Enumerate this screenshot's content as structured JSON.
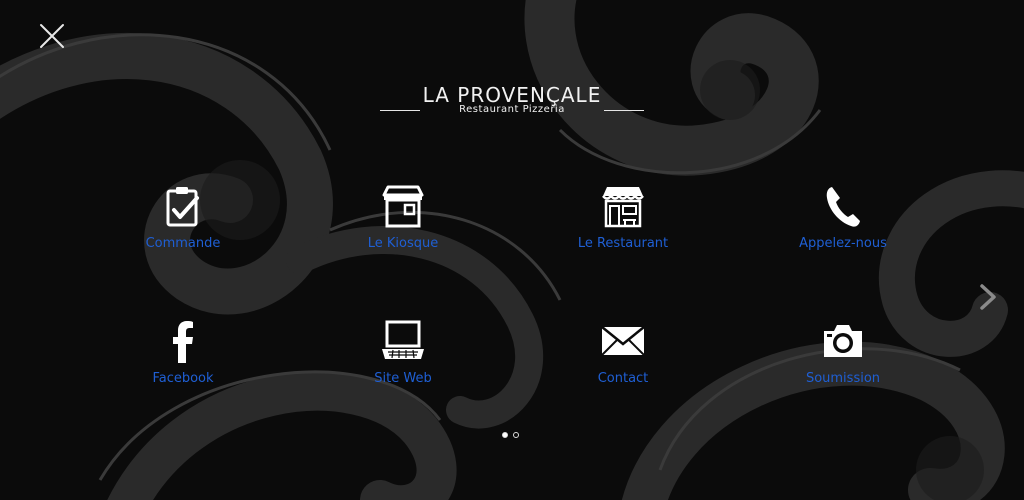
{
  "brand": {
    "title": "LA PROVENÇALE",
    "subtitle": "Restaurant Pizzeria"
  },
  "colors": {
    "background": "#0b0b0b",
    "label": "#1f5fd4",
    "icon": "#ffffff"
  },
  "menu": [
    {
      "label": "Commande",
      "icon": "clipboard-check-icon"
    },
    {
      "label": "Le Kiosque",
      "icon": "kiosk-icon"
    },
    {
      "label": "Le Restaurant",
      "icon": "restaurant-storefront-icon"
    },
    {
      "label": "Appelez-nous",
      "icon": "phone-icon"
    },
    {
      "label": "Facebook",
      "icon": "facebook-icon"
    },
    {
      "label": "Site Web",
      "icon": "laptop-icon"
    },
    {
      "label": "Contact",
      "icon": "envelope-icon"
    },
    {
      "label": "Soumission",
      "icon": "camera-icon"
    }
  ],
  "pagination": {
    "current": 1,
    "total": 2
  }
}
